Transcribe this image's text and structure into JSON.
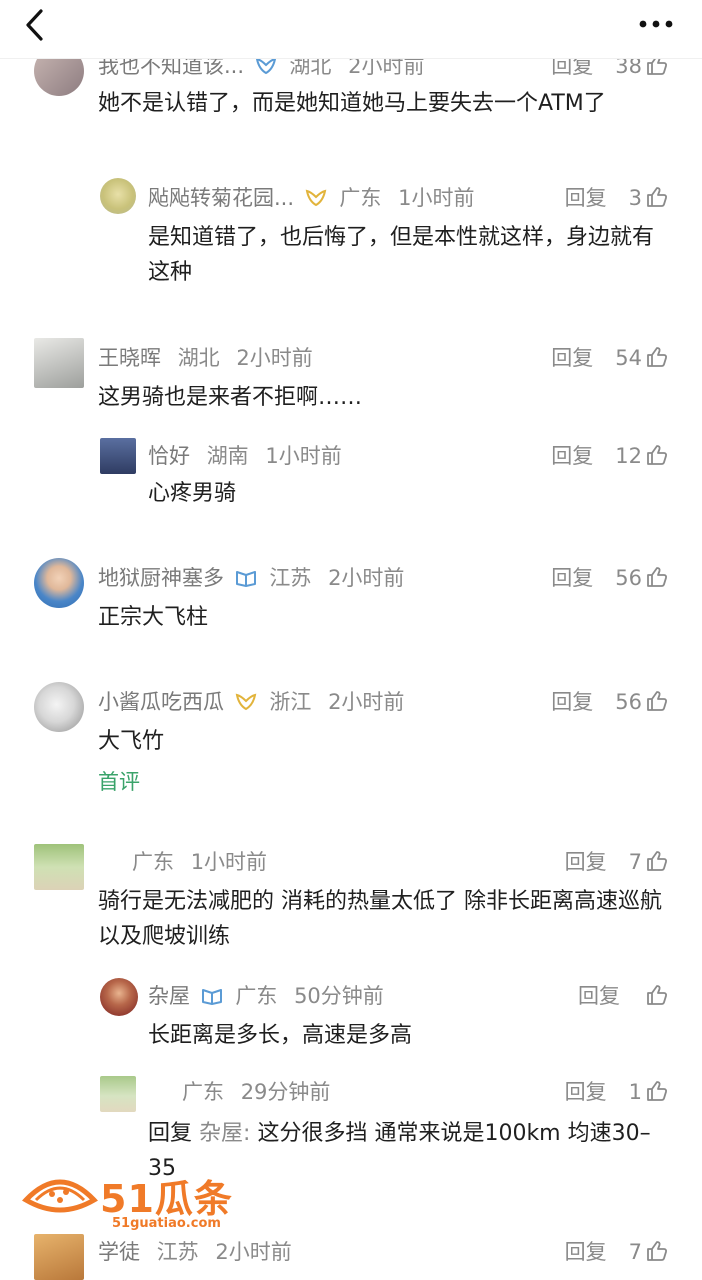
{
  "nav": {
    "back": "back-icon",
    "more": "more-icon"
  },
  "labels": {
    "reply": "回复",
    "first_comment": "首评",
    "reply_to_prefix": "回复"
  },
  "comments": [
    {
      "name": "我也不知道该...",
      "location": "湖北",
      "time": "2小时前",
      "likes": "38",
      "text": "她不是认错了，而是她知道她马上要失去一个ATM了",
      "replies": [
        {
          "name": "飐飐转菊花园...",
          "location": "广东",
          "time": "1小时前",
          "likes": "3",
          "text": "是知道错了，也后悔了，但是本性就这样，身边就有这种"
        }
      ]
    },
    {
      "name": "王晓晖",
      "location": "湖北",
      "time": "2小时前",
      "likes": "54",
      "text": "这男骑也是来者不拒啊……",
      "replies": [
        {
          "name": "恰好",
          "location": "湖南",
          "time": "1小时前",
          "likes": "12",
          "text": "心疼男骑"
        }
      ]
    },
    {
      "name": "地狱厨神塞多",
      "location": "江苏",
      "time": "2小时前",
      "likes": "56",
      "text": "正宗大飞柱"
    },
    {
      "name": "小酱瓜吃西瓜",
      "location": "浙江",
      "time": "2小时前",
      "likes": "56",
      "text": "大飞竹"
    },
    {
      "name": "",
      "location": "广东",
      "time": "1小时前",
      "likes": "7",
      "text": "骑行是无法减肥的 消耗的热量太低了 除非长距离高速巡航以及爬坡训练",
      "replies": [
        {
          "name": "杂屋",
          "location": "广东",
          "time": "50分钟前",
          "likes": "",
          "text": "长距离是多长，高速是多高"
        },
        {
          "name": "",
          "location": "广东",
          "time": "29分钟前",
          "likes": "1",
          "reply_to": "杂屋",
          "text": "这分很多挡 通常来说是100km 均速30–35"
        }
      ]
    },
    {
      "name": "学徒",
      "location": "江苏",
      "time": "2小时前",
      "likes": "7"
    }
  ],
  "watermark": {
    "brand": "51瓜条",
    "url": "51guatiao.com"
  },
  "colors": {
    "meta": "#8a8a8a",
    "text": "#1f1f1f",
    "first_tag": "#3aa36a",
    "watermark": "#f07a28"
  }
}
